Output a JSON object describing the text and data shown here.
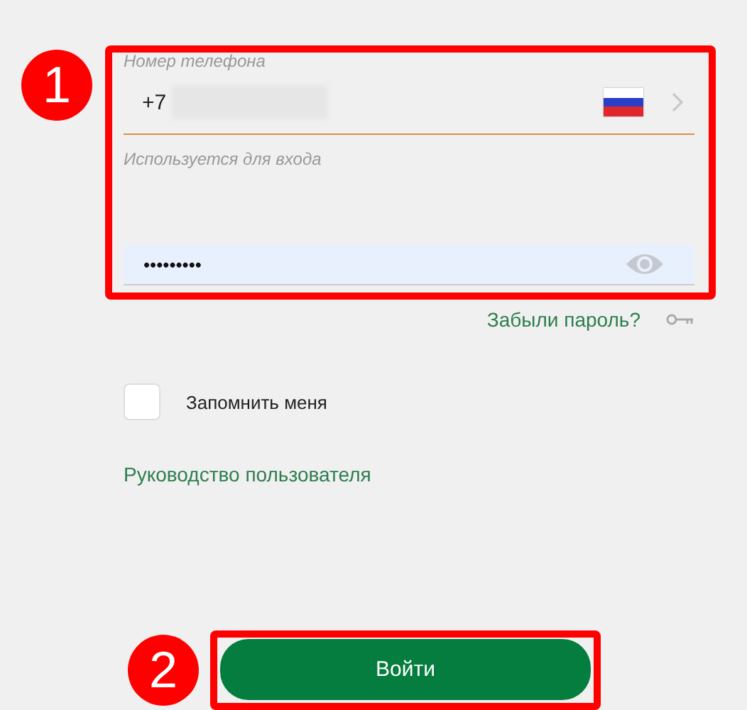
{
  "phone_field": {
    "label": "Номер телефона",
    "prefix": "+7",
    "hint": "Используется для входа"
  },
  "password_field": {
    "value": "•••••••••"
  },
  "forgot_password": "Забыли пароль?",
  "remember_me": {
    "label": "Запомнить меня",
    "checked": false
  },
  "user_guide_link": "Руководство пользователя",
  "login_button": "Войти",
  "callouts": [
    {
      "number": "1"
    },
    {
      "number": "2"
    }
  ]
}
